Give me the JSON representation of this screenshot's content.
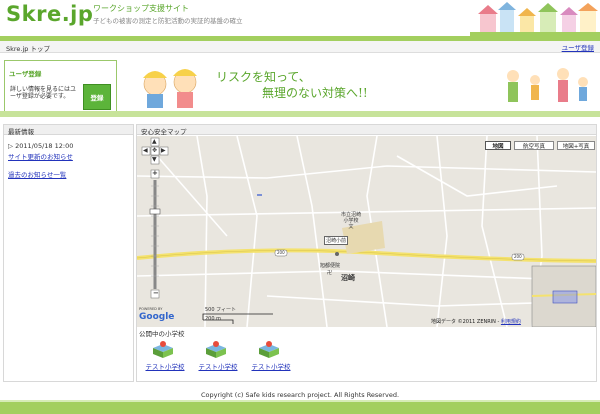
{
  "site": {
    "logo": "Skre.jp",
    "tagline": "ワークショップ支援サイト",
    "subtagline": "子どもの被害の測定と防犯活動の実証的基盤の確立"
  },
  "nav": {
    "breadcrumb": "Skre.jp トップ",
    "user_register_link": "ユーザ登録"
  },
  "login": {
    "title": "ユーザ登録",
    "message": "詳しい情報を見るにはユーザ登録が必要です。",
    "register_button": "登録"
  },
  "banner": {
    "slogan_line1": "リスクを知って、",
    "slogan_line2": "無理のない対策へ!!"
  },
  "news": {
    "heading": "最新情報",
    "date": "2011/05/18 12:00",
    "item_link": "サイト更新のお知らせ",
    "past_link": "過去のお知らせ一覧"
  },
  "map": {
    "heading": "安心安全マップ",
    "type_buttons": [
      "地図",
      "航空写真",
      "地図+写真"
    ],
    "selected_type": "地図",
    "school_label": "市立沼崎小学校",
    "school_mark": "文",
    "station_label": "沼崎小前",
    "temple_label": "旭都便院",
    "place_label": "沼崎",
    "route_number": "200",
    "scale_ft": "500 フィート",
    "scale_m": "200 m",
    "powered_by": "POWERED BY",
    "google": "Google",
    "attribution": "地図データ ©2011 ZENRIN - ",
    "attribution_link": "利用規約"
  },
  "schools": {
    "heading": "公開中の小学校",
    "items": [
      "テスト小学校",
      "テスト小学校",
      "テスト小学校"
    ]
  },
  "footer": {
    "copyright": "Copyright (c) Safe kids research project. All Rights Reserved."
  },
  "colors": {
    "brand_green": "#5aa62c",
    "band_green": "#a3cf5f",
    "link_blue": "#2233bb"
  }
}
